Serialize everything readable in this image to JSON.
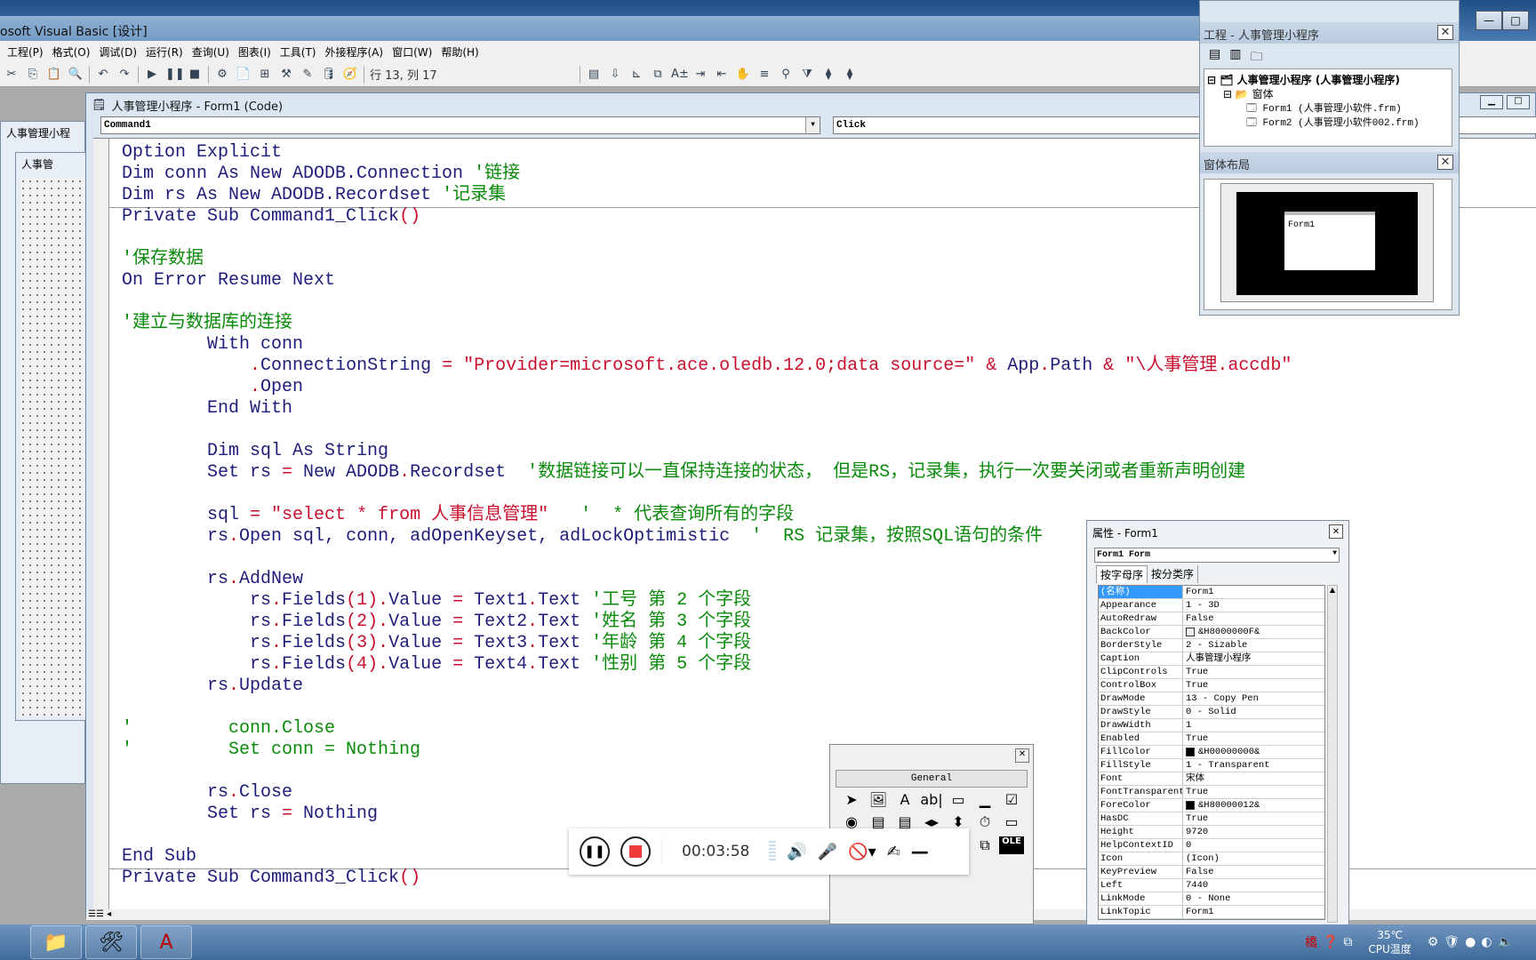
{
  "window": {
    "title": "osoft Visual Basic [设计]",
    "buttons": [
      "—",
      "□",
      "✕"
    ]
  },
  "menu": [
    "工程(P)",
    "格式(O)",
    "调试(D)",
    "运行(R)",
    "查询(U)",
    "图表(I)",
    "工具(T)",
    "外接程序(A)",
    "窗口(W)",
    "帮助(H)"
  ],
  "toolbar": {
    "position": "行 13, 列 17",
    "icons_left": [
      "✂",
      "⎘",
      "📋",
      "🔍",
      "↶",
      "↷",
      "▶",
      "❚❚",
      "■",
      "⚙",
      "📄",
      "⊞",
      "⚒",
      "✎",
      "🛢",
      "🧭"
    ],
    "icons_right": [
      "▤",
      "⇩",
      "⊾",
      "⧉",
      "A±",
      "⇥",
      "⇤",
      "✋",
      "≡",
      "⚲",
      "⧩",
      "⧫",
      "⧫"
    ]
  },
  "left_windows": {
    "outer_title": "人事管理小程",
    "inner_title": "人事管"
  },
  "code_window": {
    "title": "人事管理小程序 - Form1 (Code)",
    "object_combo": "Command1",
    "proc_combo": "Click",
    "lines": [
      [
        [
          "Option Explicit",
          ""
        ]
      ],
      [
        [
          "Dim conn As New ADODB.Connection ",
          ""
        ],
        [
          "'链接",
          "c"
        ]
      ],
      [
        [
          "Dim rs As New ADODB.Recordset ",
          ""
        ],
        [
          "'记录集",
          "c"
        ]
      ],
      [
        [
          "Private Sub Command1_Click",
          ""
        ],
        [
          "()",
          "p"
        ]
      ],
      [],
      [
        [
          "'保存数据",
          "c"
        ]
      ],
      [
        [
          "On Error Resume Next",
          ""
        ]
      ],
      [],
      [
        [
          "'建立与数据库的连接",
          "c"
        ]
      ],
      [
        [
          "        With conn",
          ""
        ]
      ],
      [
        [
          "            ",
          ""
        ],
        [
          ".",
          "p"
        ],
        [
          "ConnectionString ",
          ""
        ],
        [
          "= ",
          "p"
        ],
        [
          "\"Provider=microsoft.ace.oledb.12.0;data source=\"",
          "s"
        ],
        [
          " ",
          ""
        ],
        [
          "&",
          "p"
        ],
        [
          " App",
          ""
        ],
        [
          ".",
          "p"
        ],
        [
          "Path ",
          ""
        ],
        [
          "&",
          "p"
        ],
        [
          " ",
          ""
        ],
        [
          "\"\\人事管理.accdb\"",
          "s"
        ]
      ],
      [
        [
          "            ",
          ""
        ],
        [
          ".",
          "p"
        ],
        [
          "Open",
          ""
        ]
      ],
      [
        [
          "        End With",
          ""
        ]
      ],
      [],
      [
        [
          "        Dim sql As String",
          ""
        ]
      ],
      [
        [
          "        Set rs ",
          ""
        ],
        [
          "=",
          "p"
        ],
        [
          " New ADODB",
          ""
        ],
        [
          ".",
          "p"
        ],
        [
          "Recordset  ",
          ""
        ],
        [
          "'数据链接可以一直保持连接的状态， 但是RS，记录集，执行一次要关闭或者重新声明创建",
          "c"
        ]
      ],
      [],
      [
        [
          "        sql ",
          ""
        ],
        [
          "= ",
          "p"
        ],
        [
          "\"select * from 人事信息管理\"",
          "s"
        ],
        [
          "   ",
          ""
        ],
        [
          "'  * 代表查询所有的字段",
          "c"
        ]
      ],
      [
        [
          "        rs",
          ""
        ],
        [
          ".",
          "p"
        ],
        [
          "Open sql, conn, adOpenKeyset, adLockOptimistic  ",
          ""
        ],
        [
          "'  RS 记录集，按照SQL语句的条件",
          "c"
        ]
      ],
      [],
      [
        [
          "        rs",
          ""
        ],
        [
          ".",
          "p"
        ],
        [
          "AddNew",
          ""
        ]
      ],
      [
        [
          "            rs",
          ""
        ],
        [
          ".",
          "p"
        ],
        [
          "Fields",
          ""
        ],
        [
          "(1)",
          "p"
        ],
        [
          ".",
          "p"
        ],
        [
          "Value ",
          ""
        ],
        [
          "=",
          "p"
        ],
        [
          " Text1",
          ""
        ],
        [
          ".",
          "p"
        ],
        [
          "Text ",
          ""
        ],
        [
          "'工号 第 2 个字段",
          "c"
        ]
      ],
      [
        [
          "            rs",
          ""
        ],
        [
          ".",
          "p"
        ],
        [
          "Fields",
          ""
        ],
        [
          "(2)",
          "p"
        ],
        [
          ".",
          "p"
        ],
        [
          "Value ",
          ""
        ],
        [
          "=",
          "p"
        ],
        [
          " Text2",
          ""
        ],
        [
          ".",
          "p"
        ],
        [
          "Text ",
          ""
        ],
        [
          "'姓名 第 3 个字段",
          "c"
        ]
      ],
      [
        [
          "            rs",
          ""
        ],
        [
          ".",
          "p"
        ],
        [
          "Fields",
          ""
        ],
        [
          "(3)",
          "p"
        ],
        [
          ".",
          "p"
        ],
        [
          "Value ",
          ""
        ],
        [
          "=",
          "p"
        ],
        [
          " Text3",
          ""
        ],
        [
          ".",
          "p"
        ],
        [
          "Text ",
          ""
        ],
        [
          "'年龄 第 4 个字段",
          "c"
        ]
      ],
      [
        [
          "            rs",
          ""
        ],
        [
          ".",
          "p"
        ],
        [
          "Fields",
          ""
        ],
        [
          "(4)",
          "p"
        ],
        [
          ".",
          "p"
        ],
        [
          "Value ",
          ""
        ],
        [
          "=",
          "p"
        ],
        [
          " Text4",
          ""
        ],
        [
          ".",
          "p"
        ],
        [
          "Text ",
          ""
        ],
        [
          "'性别 第 5 个字段",
          "c"
        ]
      ],
      [
        [
          "        rs",
          ""
        ],
        [
          ".",
          "p"
        ],
        [
          "Update",
          ""
        ]
      ],
      [],
      [
        [
          "'         conn.Close",
          "c"
        ]
      ],
      [
        [
          "'         Set conn = Nothing",
          "c"
        ]
      ],
      [],
      [
        [
          "        rs",
          ""
        ],
        [
          ".",
          "p"
        ],
        [
          "Close",
          ""
        ]
      ],
      [
        [
          "        Set rs ",
          ""
        ],
        [
          "=",
          "p"
        ],
        [
          " Nothing",
          ""
        ]
      ],
      [],
      [
        [
          "End Sub",
          ""
        ]
      ],
      [
        [
          "Private Sub Command3_Click",
          ""
        ],
        [
          "()",
          "p"
        ]
      ]
    ]
  },
  "project": {
    "title": "工程 - 人事管理小程序",
    "root": "人事管理小程序 (人事管理小程序)",
    "folder": "窗体",
    "items": [
      "Form1 (人事管理小软件.frm)",
      "Form2 (人事管理小软件002.frm)"
    ],
    "layout_title": "窗体布局",
    "layout_form": "Form1"
  },
  "properties": {
    "title": "属性 - Form1",
    "object": "Form1 Form",
    "tabs": [
      "按字母序",
      "按分类序"
    ],
    "rows": [
      [
        "(名称)",
        "Form1",
        ""
      ],
      [
        "Appearance",
        "1 - 3D",
        ""
      ],
      [
        "AutoRedraw",
        "False",
        ""
      ],
      [
        "BackColor",
        "&H8000000F&",
        "#f0f0f0"
      ],
      [
        "BorderStyle",
        "2 - Sizable",
        ""
      ],
      [
        "Caption",
        "人事管理小程序",
        ""
      ],
      [
        "ClipControls",
        "True",
        ""
      ],
      [
        "ControlBox",
        "True",
        ""
      ],
      [
        "DrawMode",
        "13 - Copy Pen",
        ""
      ],
      [
        "DrawStyle",
        "0 - Solid",
        ""
      ],
      [
        "DrawWidth",
        "1",
        ""
      ],
      [
        "Enabled",
        "True",
        ""
      ],
      [
        "FillColor",
        "&H00000000&",
        "#000000"
      ],
      [
        "FillStyle",
        "1 - Transparent",
        ""
      ],
      [
        "Font",
        "宋体",
        ""
      ],
      [
        "FontTransparent",
        "True",
        ""
      ],
      [
        "ForeColor",
        "&H80000012&",
        "#000000"
      ],
      [
        "HasDC",
        "True",
        ""
      ],
      [
        "Height",
        "9720",
        ""
      ],
      [
        "HelpContextID",
        "0",
        ""
      ],
      [
        "Icon",
        "(Icon)",
        ""
      ],
      [
        "KeyPreview",
        "False",
        ""
      ],
      [
        "Left",
        "7440",
        ""
      ],
      [
        "LinkMode",
        "0 - None",
        ""
      ],
      [
        "LinkTopic",
        "Form1",
        ""
      ]
    ]
  },
  "toolbox": {
    "header": "General",
    "icons": [
      "➤",
      "🖼",
      "A",
      "ab|",
      "▭",
      "▁",
      "☑",
      "◉",
      "▤",
      "▤",
      "◂▸",
      "⬍",
      "⏱",
      "▭",
      "▭",
      "▭",
      "▭",
      "▭",
      "▭",
      "⧉",
      "OLE"
    ]
  },
  "recorder": {
    "time": "00:03:58",
    "icons": [
      "speaker-icon",
      "microphone-icon",
      "camera-off-icon",
      "pen-icon",
      "minimize-icon"
    ]
  },
  "taskbar": {
    "temp": "35℃",
    "temp_label": "CPU温度"
  },
  "colors": {
    "code_text": "#1e1e7a",
    "comment": "#0a8a0a",
    "string": "#c8102e",
    "selection": "#3399ff"
  }
}
